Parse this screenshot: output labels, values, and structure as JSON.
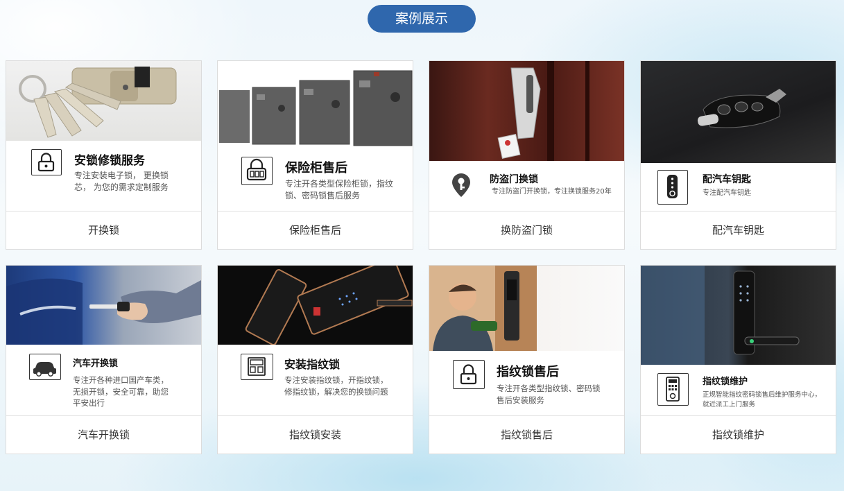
{
  "section": {
    "title": "案例展示"
  },
  "cards": [
    {
      "title": "安锁修锁服务",
      "desc": "专注安装电子锁， 更换锁芯， 为您的需求定制服务",
      "caption": "开换锁"
    },
    {
      "title": "保险柜售后",
      "desc": "专注开各类型保险柜锁，指纹锁、密码锁售后服务",
      "caption": "保险柜售后"
    },
    {
      "title": "防盗门换锁",
      "desc": "专注防盗门开换锁，专注换锁服务20年",
      "caption": "换防盗门锁"
    },
    {
      "title": "配汽车钥匙",
      "desc": "专注配汽车钥匙",
      "caption": "配汽车钥匙"
    },
    {
      "title": "汽车开换锁",
      "desc": "专注开各种进口国产车类，无损开锁，安全可靠，助您平安出行",
      "caption": "汽车开换锁"
    },
    {
      "title": "安装指纹锁",
      "desc": "专注安装指纹锁，开指纹锁，修指纹锁，解决您的换锁问题",
      "caption": "指纹锁安装"
    },
    {
      "title": "指纹锁售后",
      "desc": "专注开各类型指纹锁、密码锁售后安装服务",
      "caption": "指纹锁售后"
    },
    {
      "title": "指纹锁维护",
      "desc": "正规智能指纹密码锁售后维护服务中心，就近派工上门服务",
      "caption": "指纹锁维护"
    }
  ],
  "colors": {
    "title_pill": "#2f67ad",
    "caption_text": "#333333",
    "card_border": "#dcdcdc"
  }
}
